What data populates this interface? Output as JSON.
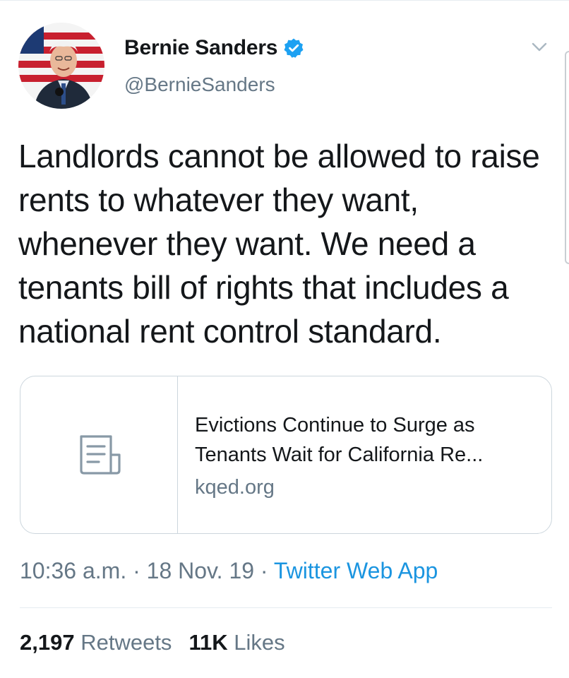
{
  "author": {
    "display_name": "Bernie Sanders",
    "handle": "@BernieSanders",
    "verified": true
  },
  "tweet": {
    "text": "Landlords cannot be allowed to raise rents to whatever they want, whenever they want. We need a tenants bill of rights that includes a national rent control standard."
  },
  "link_card": {
    "title": "Evictions Continue to Surge as Tenants Wait for California Re...",
    "domain": "kqed.org",
    "thumbnail_icon": "document-icon"
  },
  "meta": {
    "time": "10:36 a.m.",
    "separator": " · ",
    "date": "18 Nov. 19",
    "source": "Twitter Web App"
  },
  "stats": {
    "retweets_count": "2,197",
    "retweets_label": "Retweets",
    "likes_count": "11K",
    "likes_label": "Likes"
  },
  "colors": {
    "text": "#14171a",
    "secondary": "#657786",
    "accent": "#1b95e0",
    "border": "#ccd6dd"
  },
  "icons": [
    "verified-badge-icon",
    "chevron-down-icon",
    "document-icon"
  ]
}
